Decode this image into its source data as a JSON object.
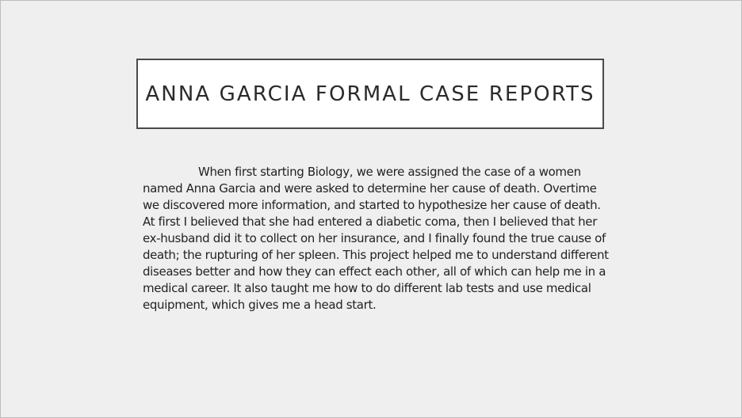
{
  "slide": {
    "title": "ANNA GARCIA FORMAL CASE REPORTS",
    "body_lines": [
      "When first starting Biology, we were assigned the case of a women",
      "named Anna Garcia and were asked to determine her cause of death. Overtime",
      "we discovered more information, and started to hypothesize her cause of death.",
      "At first I believed that she had entered a diabetic coma, then I believed that her",
      "ex-husband did it to collect on her insurance, and I finally found the true cause of",
      "death; the rupturing of her spleen. This project helped me to understand different",
      "diseases better and how they can effect each other, all of which can help me in a",
      "medical career. It also taught me how to do different lab tests and use medical",
      "equipment, which gives me a head start."
    ]
  },
  "colors": {
    "background": "#efefef",
    "title_box_fill": "#ffffff",
    "title_box_border": "#4a4a4a",
    "text": "#222222"
  }
}
